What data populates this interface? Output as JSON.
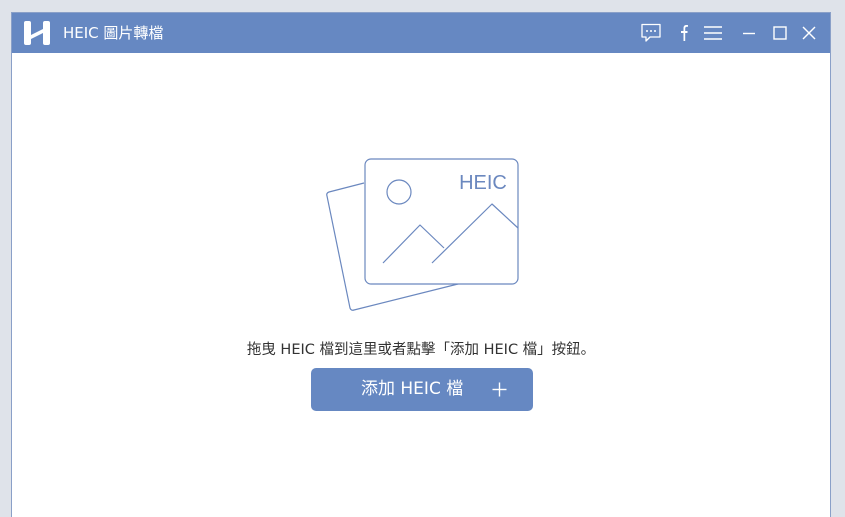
{
  "app": {
    "title": "HEIC 圖片轉檔",
    "accent_color": "#6688c2"
  },
  "titlebar": {
    "buttons": [
      {
        "name": "feedback",
        "icon": "chat-bubble-icon"
      },
      {
        "name": "facebook",
        "icon": "facebook-icon"
      },
      {
        "name": "menu",
        "icon": "hamburger-menu-icon"
      },
      {
        "name": "minimize",
        "icon": "minimize-icon"
      },
      {
        "name": "maximize",
        "icon": "maximize-icon"
      },
      {
        "name": "close",
        "icon": "close-icon"
      }
    ]
  },
  "main": {
    "illustration_label": "HEIC",
    "illustration_icon": "photo-stack-icon",
    "hint_text": "拖曳 HEIC 檔到這里或者點擊「添加 HEIC 檔」按鈕。",
    "add_button_label": "添加 HEIC 檔",
    "add_button_icon": "plus-icon"
  }
}
